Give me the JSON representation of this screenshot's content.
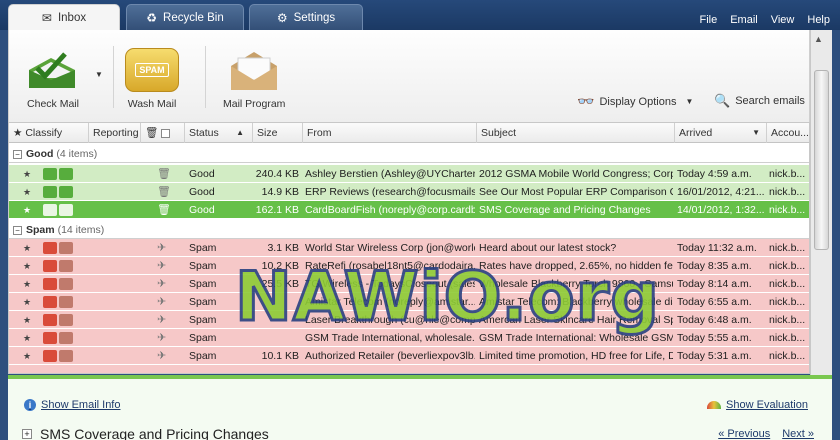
{
  "tabs": [
    {
      "label": "Inbox",
      "icon": "envelope-icon",
      "active": true
    },
    {
      "label": "Recycle Bin",
      "icon": "recycle-icon",
      "active": false
    },
    {
      "label": "Settings",
      "icon": "gear-icon",
      "active": false
    }
  ],
  "menu": [
    "File",
    "Email",
    "View",
    "Help"
  ],
  "ribbon": {
    "check_mail": "Check Mail",
    "wash_mail": "Wash Mail",
    "wash_badge": "SPAM",
    "mail_program": "Mail Program",
    "display_options": "Display Options",
    "search_emails": "Search emails"
  },
  "columns": {
    "classify": "Classify",
    "reporting": "Reporting",
    "status": "Status",
    "size": "Size",
    "from": "From",
    "subject": "Subject",
    "arrived": "Arrived",
    "account": "Accou..."
  },
  "groups": {
    "good": {
      "label": "Good",
      "count": "(4 items)"
    },
    "spam": {
      "label": "Spam",
      "count": "(14 items)"
    }
  },
  "good_rows": [
    {
      "status": "Good",
      "size": "240.4 KB",
      "from": "Ashley Berstien (Ashley@UYCharters....",
      "subject": "2012 GSMA Mobile World Congress; Corpo...",
      "arrived": "Today 4:59 a.m.",
      "account": "nick.b..."
    },
    {
      "status": "Good",
      "size": "14.9 KB",
      "from": "ERP Reviews (research@focusmails.c...",
      "subject": "See Our Most Popular ERP Comparison Gui...",
      "arrived": "16/01/2012, 4:21...",
      "account": "nick.b..."
    },
    {
      "status": "Good",
      "size": "162.1 KB",
      "from": "CardBoardFish (noreply@corp.cardbo...",
      "subject": "SMS Coverage and Pricing Changes",
      "arrived": "14/01/2012, 1:32...",
      "account": "nick.b...",
      "selected": true
    }
  ],
  "spam_rows": [
    {
      "status": "Spam",
      "size": "3.1 KB",
      "from": "World Star Wireless Corp (jon@world...",
      "subject": "Heard about our latest stock?",
      "arrived": "Today 11:32 a.m.",
      "account": "nick.b..."
    },
    {
      "status": "Spam",
      "size": "10.2 KB",
      "from": "RateRefi (rosabel18nt5@cardodaira.i...",
      "subject": "Rates have dropped, 2.65%, no hidden fees",
      "arrived": "Today 8:35 a.m.",
      "account": "nick.b..."
    },
    {
      "status": "Spam",
      "size": "25.5 KB",
      "from": "TG Wireless - TodaysCloseout (sales@...",
      "subject": "Wholesale Blackberry Torch 9860 - Samsun...",
      "arrived": "Today 8:14 a.m.",
      "account": "nick.b..."
    },
    {
      "status": "Spam",
      "size": "",
      "from": "Amistar Telecom (noreply@amistar...",
      "subject": "Amistar Telecom: Blackberry wholesale dis...",
      "arrived": "Today 6:55 a.m.",
      "account": "nick.b..."
    },
    {
      "status": "Spam",
      "size": "",
      "from": "Laser Breakthrough (cu@hle@comprar...",
      "subject": "Amercan Laser Skincare Hair Removal Spec...",
      "arrived": "Today 6:48 a.m.",
      "account": "nick.b..."
    },
    {
      "status": "Spam",
      "size": "",
      "from": "GSM Trade International, wholesale...",
      "subject": "GSM Trade International: Wholesale GSM Ph...",
      "arrived": "Today 5:55 a.m.",
      "account": "nick.b..."
    },
    {
      "status": "Spam",
      "size": "10.1 KB",
      "from": "Authorized  Retailer (beverliexpov3lb...",
      "subject": "Limited time promotion, HD free for Life, Di...",
      "arrived": "Today 5:31 a.m.",
      "account": "nick.b..."
    }
  ],
  "preview": {
    "show_info": "Show Email Info",
    "show_evaluation": "Show Evaluation",
    "title": "SMS Coverage and Pricing Changes",
    "previous": "« Previous",
    "next": "Next »"
  },
  "watermark": "NAWiO.org",
  "colors": {
    "good": "#d2ecc4",
    "good_selected": "#66c048",
    "spam": "#f6c8c8",
    "titlebar": "#1b3964"
  }
}
